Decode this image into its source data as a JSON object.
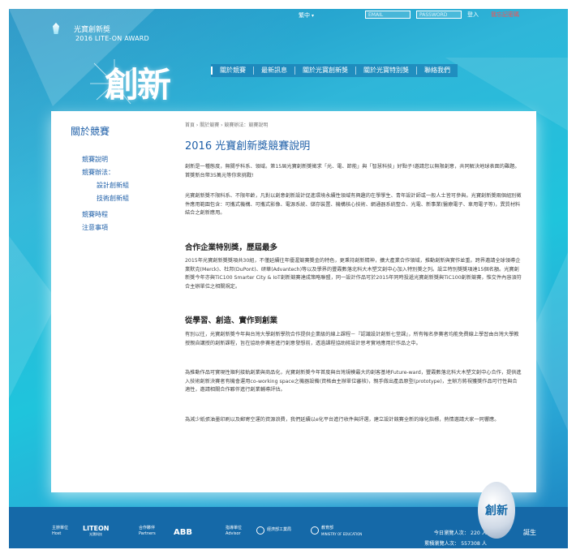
{
  "topbar": {
    "language": "繁中",
    "email_placeholder": "EMAIL",
    "password_placeholder": "PASSWORD",
    "login": "登入",
    "forgot": "我忘記密碼"
  },
  "logo": {
    "line1": "光寶創新獎",
    "line2": "2016 LITE-ON AWARD"
  },
  "hero": {
    "text": "創新"
  },
  "nav": {
    "items": [
      "關於競賽",
      "最新訊息",
      "關於光寶創新獎",
      "關於光寶特別獎",
      "聯絡我們"
    ]
  },
  "sidebar": {
    "title": "關於競賽",
    "items": [
      {
        "label": "競賽說明"
      },
      {
        "label": "競賽辦法："
      },
      {
        "label": "設計創新組"
      },
      {
        "label": "技術創新組"
      },
      {
        "label": "競賽時程"
      },
      {
        "label": "注意事項"
      }
    ]
  },
  "main": {
    "breadcrumb": "首頁 › 關於競賽 › 競賽辦法：競賽說明",
    "title": "2016 光寶創新獎競賽說明",
    "p1": "創新是一種態度，無關乎科系、領域。第15屆光寶創新獎徵求「光、電、節能」與「智慧科技」好點子!邀請您以無限創意，共同解決地球表面的難題。首獎新台幣35萬元等你來挑戰!",
    "p2": "光寶創新獎不限科系、不限年齡，凡對以創意創新設計促進環境永續性領域有興趣的在學學生、青年設計師或一般人士皆可參與。光寶創新獎兩個組別徵件應用範圍包含：可攜式機構、可攜式影像、電源系統、儲存裝置、機構核心技術、網通器系統整合、光電、新事業(醫療電子、車用電子等)，異質材料結合之創新應用。",
    "h1": "合作企業特別獎，歷屆最多",
    "p3": "2015年光寶創新獎獎項共30組，不僅延續往年優渥競賽獎金的特色，更秉持創新精神，擴大產業合作領域，推動創新與實作並重。跨界邀請全球領導企業默克(Merck)、杜邦(DuPont)、研華(Advantech)等以及學界的豐霞數落北科大木塑文創中心加入特別獎之列。設立特別獎獎項達15個名額。光寶創新獎今年亦與TiC100 Smarter City & IoT創新競賽達成策略聯盟，同一設計作品可於2015年同時投遞光寶創新獎與TiC100創新競賽，惟交件內容須符合主辦單位之相關規定。",
    "h2": "從學習、創造、實作到創業",
    "p4": "有別以往，光寶創新獎今年與台灣大學創新學院合作提供企業級的線上課程－『認識設計創新七堂課』，所有報名參賽者均能免費線上學習由台灣大學教授親自講授的創新課程，旨在協助參賽者進行創意發想前，透過課程協助將設計思考實地應用於作品之中。",
    "p5": "為推動作品可實現性順利接軌創業與商品化，光寶創新獎今年首度與台灣規模最大的創客基地Future-ward，豐霞數落北科大木塑文創中心合作，提供進入技術創新決賽者有機會運用co-working space之機器設備(資格由主辦單位審核)，親手做出產品原型(prototype)，主辦方將視獲獎作品可行性與合適性，邀請相關合作夥伴進行創業輔導評估。",
    "p6": "為減少紙張油墨印刷以及郵寄空運的資源浪費，我們延續以e化平台進行收件與評選，建立設計競賽全新的綠化指標，熱情邀請大家一同響應。"
  },
  "footer": {
    "host_label_cn": "主辦單位",
    "host_label_en": "Host",
    "host_logo": "LITEON",
    "host_logo_sub": "光寶科技",
    "partners_label_cn": "合作夥伴",
    "partners_label_en": "Partners",
    "partner_logo": "ABB",
    "advisor_label_cn": "指導單位",
    "advisor_label_en": "Advisor",
    "advisor1_cn": "經濟部工業局",
    "advisor2_cn": "教育部",
    "advisor2_en": "MINISTRY OF EDUCATION",
    "today_label": "今日瀏覽人次：",
    "today_value": "220",
    "today_unit": "人",
    "total_label": "累積瀏覽人次：",
    "total_value": "557308",
    "total_unit": "人",
    "badge_text": "創新",
    "badge_word": "誕生"
  },
  "colors": {
    "accent": "#1e5fa8",
    "footer": "#1569a8",
    "forgot": "#ff4d4d"
  }
}
